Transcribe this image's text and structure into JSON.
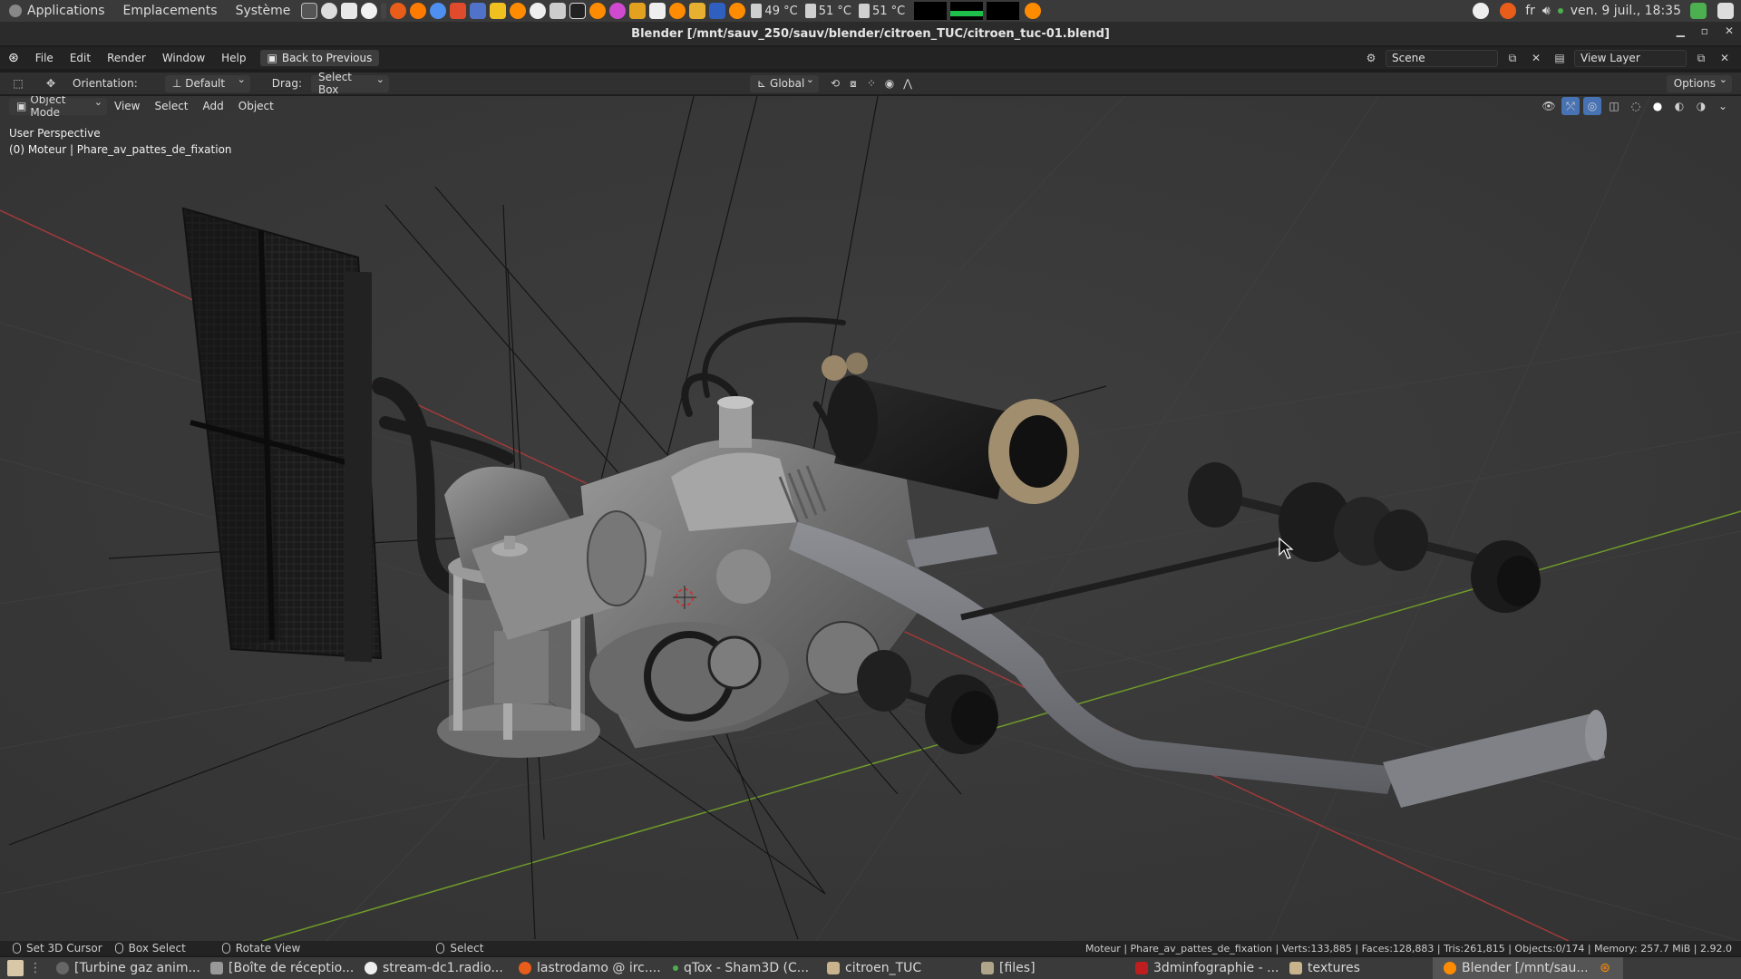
{
  "system_panel": {
    "menus": [
      "Applications",
      "Emplacements",
      "Système"
    ],
    "temps": [
      "49 °C",
      "51 °C",
      "51 °C"
    ],
    "keyboard": "fr",
    "clock": "ven. 9 juil., 18:35"
  },
  "window": {
    "title": "Blender [/mnt/sauv_250/sauv/blender/citroen_TUC/citroen_tuc-01.blend]"
  },
  "topbar": {
    "menus": [
      "File",
      "Edit",
      "Render",
      "Window",
      "Help"
    ],
    "back_button": "Back to Previous",
    "scene": "Scene",
    "view_layer": "View Layer"
  },
  "tool_header": {
    "orientation_label": "Orientation:",
    "orientation_value": "Default",
    "drag_label": "Drag:",
    "drag_value": "Select Box",
    "transform_orientation": "Global",
    "options": "Options"
  },
  "viewport_header": {
    "mode": "Object Mode",
    "menus": [
      "View",
      "Select",
      "Add",
      "Object"
    ]
  },
  "viewport": {
    "perspective": "User Perspective",
    "active_object": "(0) Moteur | Phare_av_pattes_de_fixation"
  },
  "status_bar": {
    "hints": [
      "Set 3D Cursor",
      "Box Select",
      "Rotate View",
      "Select"
    ],
    "stats": "Moteur | Phare_av_pattes_de_fixation | Verts:133,885 | Faces:128,883 | Tris:261,815 | Objects:0/174 | Memory: 257.7 MiB | 2.92.0"
  },
  "taskbar": {
    "tasks": [
      "[Turbine gaz anim...",
      "[Boîte de réceptio...",
      "stream-dc1.radio...",
      "lastrodamo @ irc....",
      "qTox - Sham3D (C...",
      "citroen_TUC",
      "[files]",
      "3dminfographie - ...",
      "textures",
      "Blender [/mnt/sau..."
    ]
  },
  "colors": {
    "x_axis": "#a33a3a",
    "y_axis": "#6f9b2a",
    "viewport_bg": "#393939"
  }
}
